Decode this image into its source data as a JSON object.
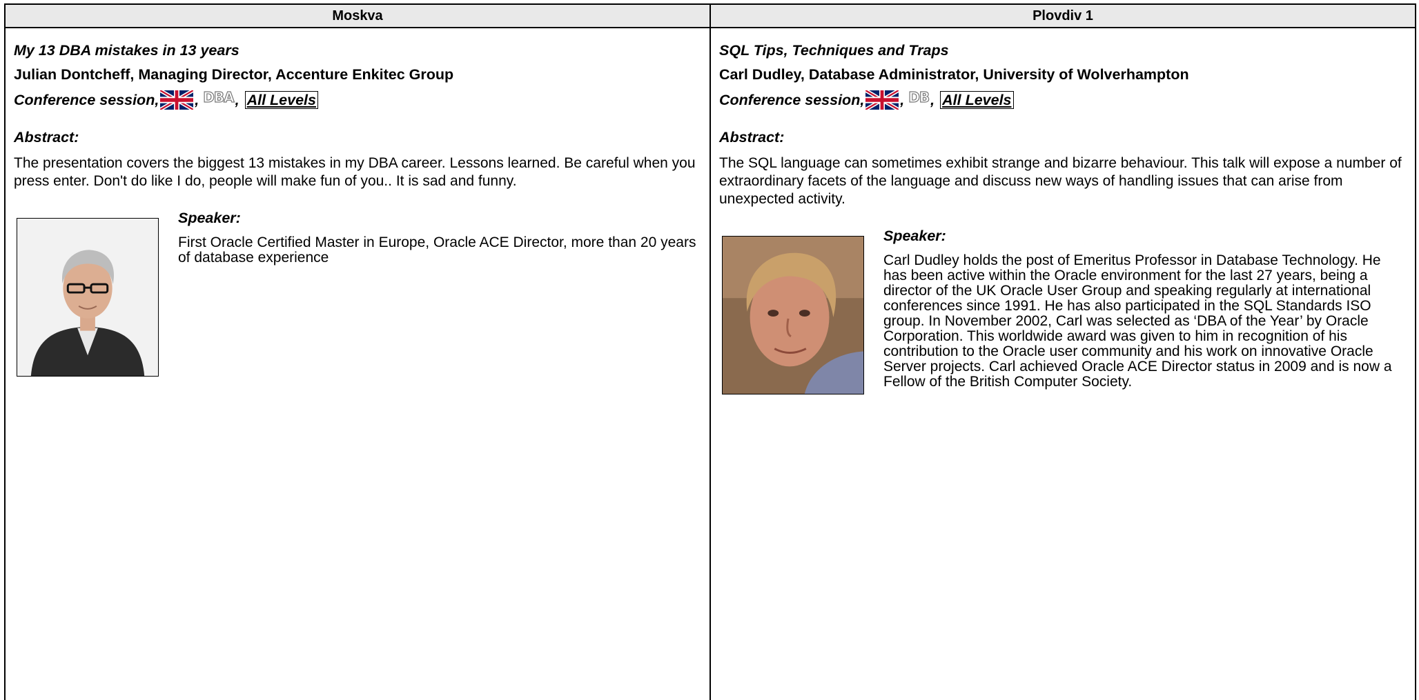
{
  "columns": [
    {
      "room": "Moskva",
      "title": "My 13 DBA mistakes in 13 years",
      "speaker_line": "Julian Dontcheff, Managing Director, Accenture Enkitec Group",
      "session_type": "Conference session,",
      "topic_badge": "DBA",
      "level": "All Levels",
      "abstract_heading": "Abstract:",
      "abstract": "The presentation covers the biggest 13 mistakes in my DBA career. Lessons learned. Be careful when you press enter. Don't do like I do, people will make fun of you.. It is sad and funny.",
      "speaker_heading": "Speaker:",
      "bio": "First Oracle Certified Master in Europe, Oracle ACE Director, more than 20 years of database experience"
    },
    {
      "room": "Plovdiv 1",
      "title": "SQL Tips, Techniques and Traps",
      "speaker_line": "Carl Dudley, Database Administrator, University of Wolverhampton",
      "session_type": "Conference session,",
      "topic_badge": "DB",
      "level": "All Levels",
      "abstract_heading": "Abstract:",
      "abstract": "The SQL language can sometimes exhibit strange and bizarre behaviour. This talk will expose a number of extraordinary facets of the language and discuss new ways of handling issues that can arise from unexpected activity.",
      "speaker_heading": "Speaker:",
      "bio": "Carl Dudley holds the post of Emeritus Professor in Database Technology. He has been active within the Oracle environment for the last 27 years, being a director of the UK Oracle User Group and speaking regularly at international conferences since 1991. He has also participated in the SQL Standards ISO group. In November 2002, Carl was selected as ‘DBA of the Year’ by Oracle Corporation. This worldwide award was given to him in recognition of his contribution to the Oracle user community and his work on innovative Oracle Server projects. Carl achieved Oracle ACE Director status in 2009 and is now a Fellow of the British Computer Society."
    }
  ],
  "icons": {
    "language_flag": "uk-flag-icon"
  },
  "colors": {
    "header_bg": "#e9e9e9",
    "flag_blue": "#012169",
    "flag_red": "#C8102E"
  }
}
